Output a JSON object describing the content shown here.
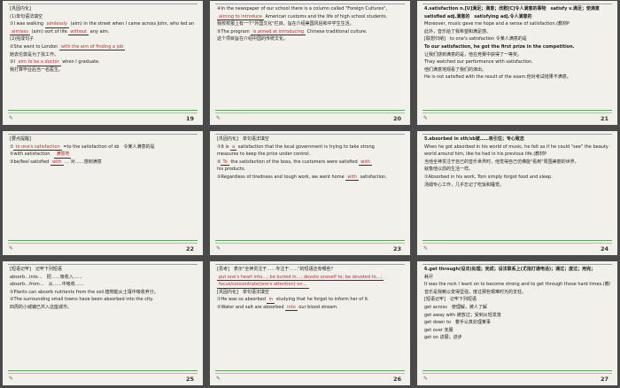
{
  "slides": [
    {
      "num": "19",
      "lines": [
        {
          "t": "[巩固内化]"
        },
        {
          "t": "(1)单句语法填空"
        },
        {
          "t": "①I was walking ",
          "f": "aimlessly",
          "t2": " (aim) in the street when I came across John, who led an"
        },
        {
          "t": "",
          "f": "aimless",
          "t2": " (aim) sort of life ",
          "f2": "without",
          "t3": " any aim."
        },
        {
          "t": "(2)完成句子"
        },
        {
          "t": "②She went to London ",
          "f": "with the aim of finding a job"
        },
        {
          "t": "她去伦敦是为了找工作。"
        },
        {
          "t": "③I ",
          "f": "aim to be a doctor",
          "t2": " when I graduate."
        },
        {
          "t": "我打算毕业后当一名医生。"
        }
      ]
    },
    {
      "num": "20",
      "lines": [
        {
          "t": "④In the newspaper of our school there is a column called \"Foreign Cultures\","
        },
        {
          "t": "",
          "f": "aiming to introduce",
          "t2": " American customs and the life of high school students."
        },
        {
          "t": "我校校报上有一个\"外国文化\"栏目，旨在介绍美国风俗和中学生生活。"
        },
        {
          "t": "⑤The program ",
          "f": "is aimed at introducing",
          "t2": " Chinese traditional culture."
        },
        {
          "t": "这个项目旨在介绍中国的传统文化。"
        }
      ]
    },
    {
      "num": "21",
      "lines": [
        {
          "t": "4.satisfaction n.[U]满足；满意；欣慰[C]令人满意的事物　satisfy v.满足；使满意",
          "cls": "b"
        },
        {
          "t": "satisfied adj.满意的　satisfying adj.令人满意的",
          "cls": "b"
        },
        {
          "t": "Moreover, music gave me hope and a sense of satisfaction.(教材P"
        },
        {
          "t": "此外，音乐给了我希望和满足感。"
        },
        {
          "t": "[联想归纳]　to one's satisfaction 令某人满意的是"
        },
        {
          "t": "To our satisfaction, he got the first prize in the competition.",
          "cls": "b"
        },
        {
          "t": "让我们感到满意的是，他在竞赛中获得了一等奖。"
        },
        {
          "t": "They watched our performance with satisfaction."
        },
        {
          "t": "他们满意地观看了我们的演出。"
        },
        {
          "t": "He is not satisfied with the result of the exam.他对考试结果不满意。"
        }
      ]
    },
    {
      "num": "22",
      "lines": [
        {
          "t": "[要点提醒]"
        },
        {
          "t": "①",
          "f": "to one's satisfaction",
          "t2": " =to the satisfaction of sb　令某人满意的是"
        },
        {
          "t": "②with satisfaction　",
          "f": "满意地"
        },
        {
          "t": "③be/feel satisfied ",
          "f": "with",
          "t2": " … 对……感到满意"
        }
      ]
    },
    {
      "num": "23",
      "lines": [
        {
          "t": "[巩固内化]　单句语法填空"
        },
        {
          "t": "①It is ",
          "f": "a",
          "t2": " satisfaction that the local government is trying to take strong"
        },
        {
          "t": "measures to keep the price under control."
        },
        {
          "t": "②",
          "f": "To",
          "t2": " the satisfaction of the boss, the customers were satisfied ",
          "f2": "with"
        },
        {
          "t": "his products."
        },
        {
          "t": "③Regardless of tiredness and tough work, we went home ",
          "f": "with",
          "t2": " satisfaction."
        }
      ]
    },
    {
      "num": "24",
      "lines": [
        {
          "t": "5.absorbed in sth/sb被……吸引住；专心致志",
          "cls": "b"
        },
        {
          "t": "When he got absorbed in his world of music, he felt as if he could \"see\" the beauty of the"
        },
        {
          "t": "world around him, like he had in his previous life.(教材P"
        },
        {
          "t": "当他全神贯注于自己的音乐世界时，他觉得自己仿佛能\"看到\"周围美丽的世界，"
        },
        {
          "t": "就像他以前的生活一样。"
        },
        {
          "t": "①Absorbed in his work, Tom simply forgot food and sleep."
        },
        {
          "t": "汤姆专心工作，几乎忘记了吃饭和睡觉。"
        }
      ]
    },
    {
      "num": "25",
      "lines": [
        {
          "t": "[短语记牢]　记牢下列短语"
        },
        {
          "t": "absorb…into…　把……吸收入……"
        },
        {
          "t": "absorb…from…　从……中吸收……"
        },
        {
          "t": "②Plants can absorb nutrients from the soil.植物能从土壤中吸收养分。"
        },
        {
          "t": "③The surrounding small towns have been absorbed into the city."
        },
        {
          "t": "四周的小城镇已并入这座城市。"
        }
      ]
    },
    {
      "num": "26",
      "lines": [
        {
          "t": "[思考]　表示\"全神贯注于……专注于……\"的短语还有哪些？"
        },
        {
          "t": "",
          "f": "put one's heart into…; be buried in…; devote oneself to; be devoted to…;"
        },
        {
          "t": "",
          "f": "focus/concentrate(one's attention) on…"
        },
        {
          "t": "[巩固内化]　单句语法填空"
        },
        {
          "t": "①He was so absorbed ",
          "f": "in",
          "t2": " studying that he forgot to inform her of it."
        },
        {
          "t": "②Water and salt are absorbed ",
          "f": "into",
          "t2": " our blood stream."
        }
      ]
    },
    {
      "num": "27",
      "lines": [
        {
          "t": "6.get through(设法)处理；完成；设法联系上(尤指打通电话)；通过；度过；用完；",
          "cls": "b"
        },
        {
          "t": "耗尽"
        },
        {
          "t": "It was the rock I leant on to become strong and to get through those hard times.(教材P"
        },
        {
          "t": "音乐是我赖以变得坚强，度过那些艰难时光的支柱。"
        },
        {
          "t": "[短语记牢]　记牢下列短语"
        },
        {
          "t": "get across　使理解，被人了解"
        },
        {
          "t": "get away with 被放过；受到从轻发落"
        },
        {
          "t": "get down to　着手认真处理某事"
        },
        {
          "t": "get over 克服"
        },
        {
          "t": "get on 进展；进步"
        }
      ]
    }
  ]
}
